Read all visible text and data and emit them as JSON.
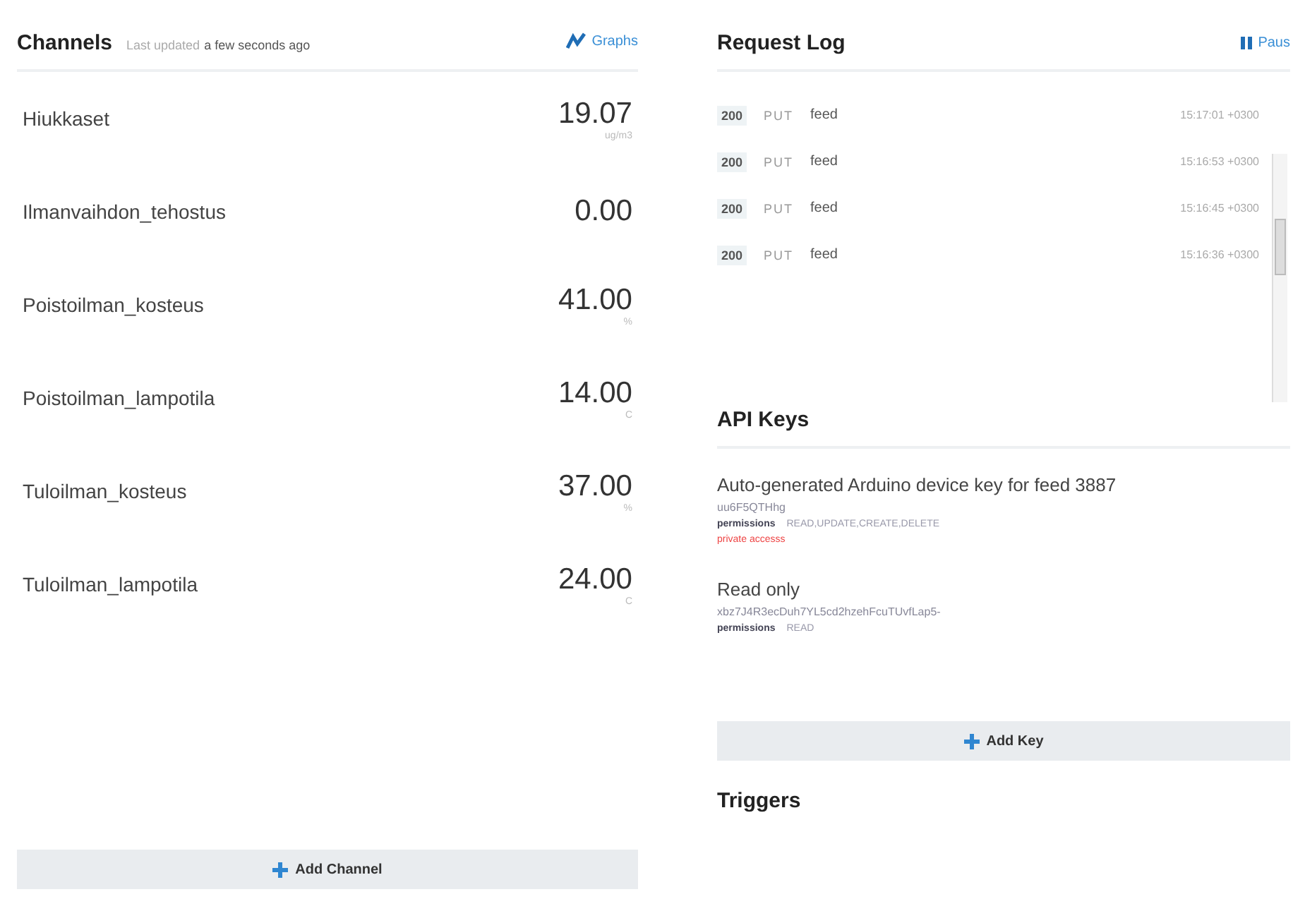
{
  "channels_panel": {
    "title": "Channels",
    "updated_label": "Last updated",
    "updated_value": "a few seconds ago",
    "graphs_link": "Graphs",
    "channels": [
      {
        "name": "Hiukkaset",
        "value": "19.07",
        "unit": "ug/m3"
      },
      {
        "name": "Ilmanvaihdon_tehostus",
        "value": "0.00"
      },
      {
        "name": "Poistoilman_kosteus",
        "value": "41.00",
        "unit": "%"
      },
      {
        "name": "Poistoilman_lampotila",
        "value": "14.00",
        "unit": "C"
      },
      {
        "name": "Tuloilman_kosteus",
        "value": "37.00",
        "unit": "%"
      },
      {
        "name": "Tuloilman_lampotila",
        "value": "24.00",
        "unit": "C"
      }
    ],
    "add_button": "Add Channel"
  },
  "request_log": {
    "title": "Request Log",
    "pause_button": "Paus",
    "rows": [
      {
        "status": "200",
        "method": "PUT",
        "path": "feed",
        "time": "15:17:01 +0300"
      },
      {
        "status": "200",
        "method": "PUT",
        "path": "feed",
        "time": "15:16:53 +0300"
      },
      {
        "status": "200",
        "method": "PUT",
        "path": "feed",
        "time": "15:16:45 +0300"
      },
      {
        "status": "200",
        "method": "PUT",
        "path": "feed",
        "time": "15:16:36 +0300"
      }
    ]
  },
  "api_keys": {
    "title": "API Keys",
    "keys": [
      {
        "name": "Auto-generated Arduino device key for feed 3887",
        "key": "uu6F5QTHhg",
        "permissions_label": "permissions",
        "permissions": "READ,UPDATE,CREATE,DELETE",
        "note": "private accesss"
      },
      {
        "name": "Read only",
        "key": "xbz7J4R3ecDuh7YL5cd2hzehFcuTUvfLap5-",
        "permissions_label": "permissions",
        "permissions": "READ"
      }
    ],
    "add_button": "Add Key"
  },
  "triggers": {
    "title": "Triggers"
  }
}
